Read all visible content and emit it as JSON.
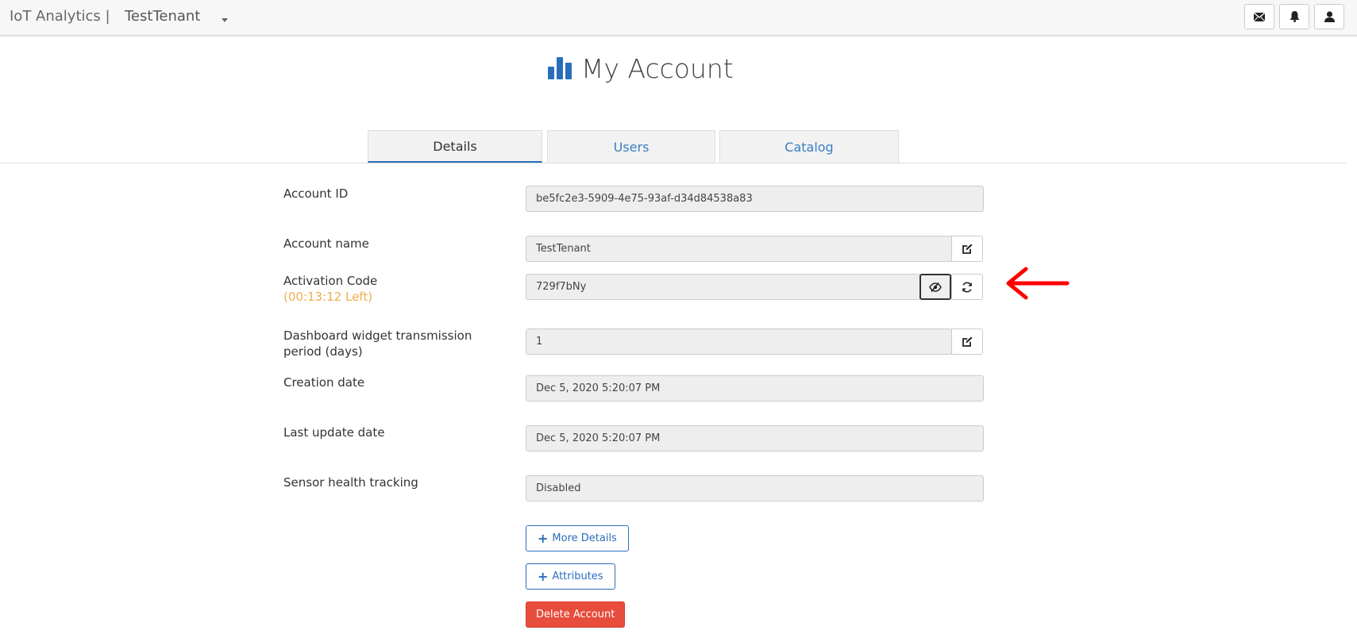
{
  "topbar": {
    "brand": "IoT Analytics |",
    "tenant": "TestTenant",
    "icons": [
      "mail-icon",
      "bell-icon",
      "user-icon"
    ]
  },
  "header": {
    "title": "My Account",
    "icon": "bar-chart-icon"
  },
  "tabs": [
    {
      "label": "Details",
      "active": true
    },
    {
      "label": "Users",
      "active": false
    },
    {
      "label": "Catalog",
      "active": false
    }
  ],
  "form": {
    "account_id": {
      "label": "Account ID",
      "value": "be5fc2e3-5909-4e75-93af-d34d84538a83"
    },
    "account_name": {
      "label": "Account name",
      "value": "TestTenant"
    },
    "activation_code": {
      "label": "Activation Code",
      "time_left": "(00:13:12 Left)",
      "value": "729f7bNy"
    },
    "dashboard_period": {
      "label": "Dashboard widget transmission period (days)",
      "value": "1"
    },
    "creation_date": {
      "label": "Creation date",
      "value": "Dec 5, 2020 5:20:07 PM"
    },
    "last_update_date": {
      "label": "Last update date",
      "value": "Dec 5, 2020 5:20:07 PM"
    },
    "sensor_health": {
      "label": "Sensor health tracking",
      "value": "Disabled"
    }
  },
  "buttons": {
    "more_details": "More Details",
    "attributes": "Attributes",
    "delete_account": "Delete Account"
  },
  "colors": {
    "accent": "#2a6ebb",
    "danger": "#e74c3c",
    "warning": "#f0ad4e",
    "annotation_arrow": "#ff0000"
  }
}
